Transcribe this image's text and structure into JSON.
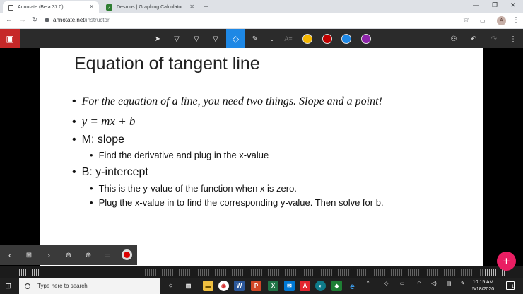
{
  "browser": {
    "tabs": [
      {
        "title": "Annotate (Beta 37.0)",
        "active": true
      },
      {
        "title": "Desmos | Graphing Calculator",
        "active": false
      }
    ],
    "url_host": "annotate.net",
    "url_path": "/instructor",
    "profile_initial": "A"
  },
  "toolbar": {
    "colors": [
      "#f5b700",
      "#c00000",
      "#1e88e5",
      "#8e24aa"
    ],
    "highlight": "#1e88e5"
  },
  "slide": {
    "title": "Equation of tangent line",
    "bullets": {
      "b1": "For the equation of a line, you need two things. Slope and a point!",
      "b2": "y = mx + b",
      "b3": "M: slope",
      "b3_1": "Find the derivative and plug in the x-value",
      "b4": "B: y-intercept",
      "b4_1": "This is the y-value of the function when x is zero.",
      "b4_2": "Plug the x-value in to find the corresponding y-value. Then solve for b."
    }
  },
  "taskbar": {
    "search_placeholder": "Type here to search",
    "time": "10:15 AM",
    "date": "5/18/2020",
    "notifications": "1"
  }
}
